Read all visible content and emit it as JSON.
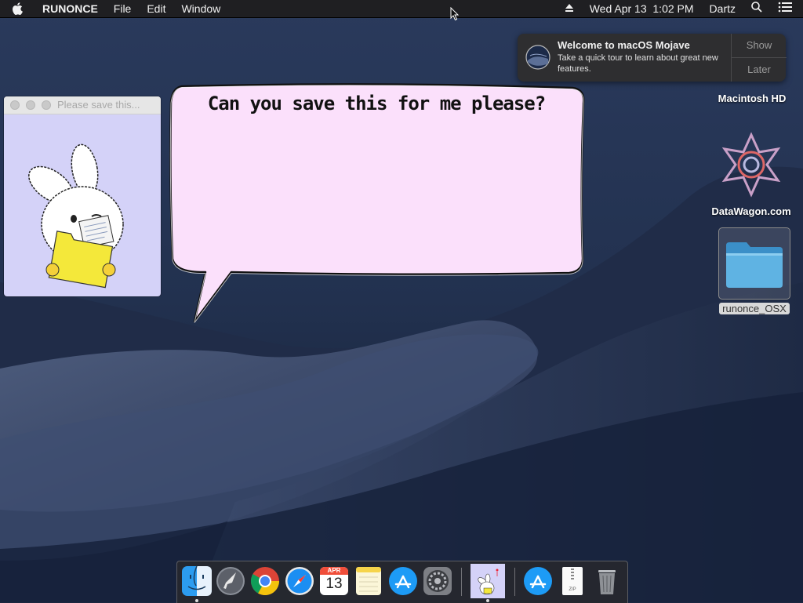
{
  "menubar": {
    "app_name": "RUNONCE",
    "menus": [
      "File",
      "Edit",
      "Window"
    ],
    "clock": "Wed Apr 13  1:02 PM",
    "user": "Dartz"
  },
  "helper_window": {
    "title": "Please save this..."
  },
  "speech_bubble": {
    "text": "Can you save this for me please?"
  },
  "notification": {
    "title": "Welcome to macOS Mojave",
    "body": "Take a quick tour to learn about great new features.",
    "show_label": "Show",
    "later_label": "Later"
  },
  "desktop_icons": {
    "hd_label": "Macintosh HD",
    "datawagon_label": "DataWagon.com",
    "folder_label": "runonce_OSX"
  },
  "dock": {
    "apps": [
      "finder",
      "launchpad",
      "chrome",
      "safari",
      "calendar",
      "notes",
      "app-store",
      "system-preferences",
      "runonce",
      "downloads",
      "zip-archive",
      "trash"
    ],
    "calendar_month": "APR",
    "calendar_day": "13",
    "zip_label": "ZIP"
  },
  "colors": {
    "bubble_fill": "#fbe0fb",
    "helper_bg": "#d4d2f8",
    "menubar": "#1f1f22"
  }
}
